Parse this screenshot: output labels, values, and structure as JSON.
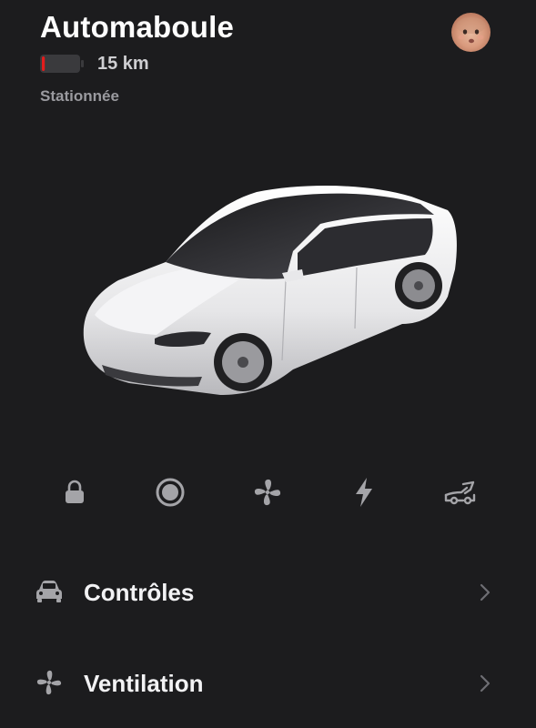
{
  "vehicle": {
    "name": "Automaboule",
    "range": "15 km",
    "status": "Stationnée",
    "battery_level": 0.08
  },
  "quick_actions": [
    {
      "icon": "lock-icon"
    },
    {
      "icon": "record-icon"
    },
    {
      "icon": "fan-icon"
    },
    {
      "icon": "lightning-icon"
    },
    {
      "icon": "frunk-icon"
    }
  ],
  "menu": [
    {
      "label": "Contrôles",
      "icon": "car-icon"
    },
    {
      "label": "Ventilation",
      "icon": "fan-icon"
    }
  ],
  "colors": {
    "background": "#1c1c1e",
    "battery_low": "#e31c1c",
    "icon_gray": "#a4a4a8",
    "text_secondary": "#9a9a9f"
  }
}
